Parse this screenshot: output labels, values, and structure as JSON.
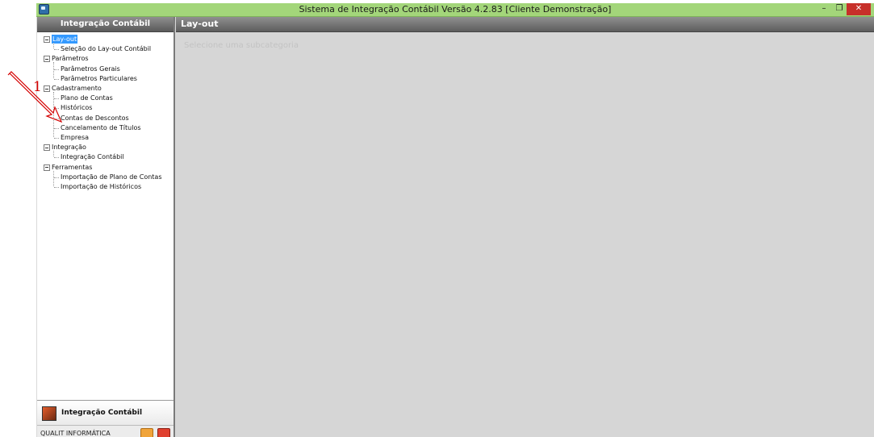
{
  "window": {
    "title": "Sistema de Integração Contábil Versão 4.2.83 [Cliente Demonstração]",
    "controls": {
      "minimize": "–",
      "restore": "❐",
      "close": "✕"
    }
  },
  "sidebar": {
    "header": "Integração Contábil",
    "tree": [
      {
        "label": "Lay-out",
        "selected": true,
        "children": [
          "Seleção do Lay-out Contábil"
        ]
      },
      {
        "label": "Parâmetros",
        "children": [
          "Parâmetros Gerais",
          "Parâmetros Particulares"
        ]
      },
      {
        "label": "Cadastramento",
        "children": [
          "Plano de Contas",
          "Históricos",
          "Contas de Descontos",
          "Cancelamento de Títulos",
          "Empresa"
        ]
      },
      {
        "label": "Integração",
        "children": [
          "Integração Contábil"
        ]
      },
      {
        "label": "Ferramentas",
        "children": [
          "Importação de Plano de Contas",
          "Importação de Históricos"
        ]
      }
    ],
    "footer_label": "Integração Contábil",
    "company": "QUALIT INFORMÁTICA"
  },
  "content": {
    "header": "Lay-out",
    "hint": "Selecione uma subcategoria"
  },
  "annotation": {
    "number": "1",
    "color": "#d40000"
  },
  "colors": {
    "titlebar": "#a3d67a",
    "selection": "#3399ff",
    "close_button": "#c7302a"
  }
}
